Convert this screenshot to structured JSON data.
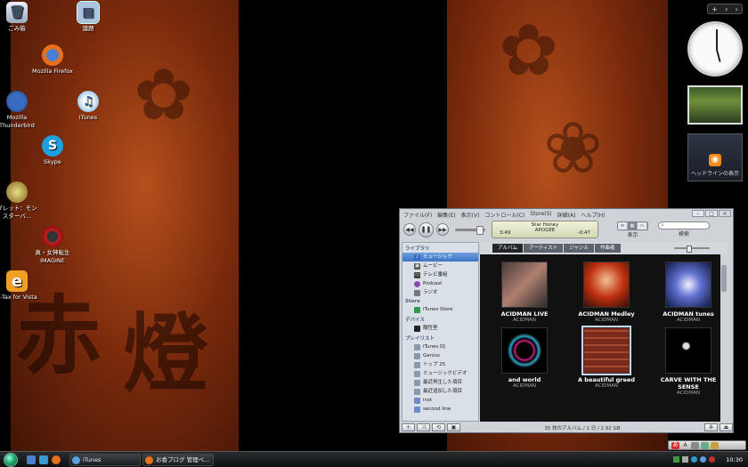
{
  "desktop": {
    "icons": [
      {
        "label": "ごみ箱",
        "icon": "recycle-bin-icon"
      },
      {
        "label": "議題",
        "icon": "document-icon"
      },
      {
        "label": "Mozilla Firefox",
        "icon": "firefox-icon"
      },
      {
        "label": "Mozilla Thunderbird",
        "icon": "thunderbird-icon"
      },
      {
        "label": "iTunes",
        "icon": "itunes-icon"
      },
      {
        "label": "Skype",
        "icon": "skype-icon"
      },
      {
        "label": "ダレット：モンスターバ…",
        "icon": "game-icon"
      },
      {
        "label": "真・女神転生IMAGINE",
        "icon": "imagine-icon"
      },
      {
        "label": "e-Tax for Vista",
        "icon": "etax-icon"
      }
    ]
  },
  "sidebar": {
    "feed_label": "ヘッドラインの表示"
  },
  "itunes": {
    "menu": [
      "ファイル(F)",
      "編集(E)",
      "表示(V)",
      "コントロール(C)",
      "Store(S)",
      "詳細(A)",
      "ヘルプ(H)"
    ],
    "now_playing": {
      "title": "Star Honey",
      "artist": "APOGEE",
      "elapsed": "3:49",
      "remaining": "-0:47"
    },
    "view_label": "表示",
    "search_label": "検索",
    "library_header": "ライブラリ",
    "library_items": [
      "ミュージック",
      "ムービー",
      "テレビ番組",
      "Podcast",
      "ラジオ"
    ],
    "store_header": "Store",
    "store_items": [
      "iTunes Store"
    ],
    "devices_header": "デバイス",
    "devices_items": [
      "酸性室"
    ],
    "playlists_header": "プレイリスト",
    "playlist_items": [
      "iTunes DJ",
      "Genius",
      "トップ 25",
      "ミュージックビデオ",
      "最近再生した項目",
      "最近追加した項目",
      "inst",
      "second line"
    ],
    "tabs": [
      "アルバム",
      "アーティスト",
      "ジャンル",
      "作曲者"
    ],
    "albums": [
      {
        "title": "ACIDMAN LIVE",
        "artist": "ACIDMAN"
      },
      {
        "title": "ACIDMAN Medley",
        "artist": "ACIDMAN"
      },
      {
        "title": "ACIDMAN tunes",
        "artist": "ACIDMAN"
      },
      {
        "title": "and world",
        "artist": "ACIDMAN"
      },
      {
        "title": "A beautiful greed",
        "artist": "ACIDMAN"
      },
      {
        "title": "CARVE WITH THE SENSE",
        "artist": "ACIDMAN"
      }
    ],
    "status": "35 枚のアルバム / 1 日 / 2.92 GB"
  },
  "taskbar": {
    "buttons": [
      "iTunes",
      "お香ブログ 管理ペ…"
    ],
    "time": "10:30"
  }
}
